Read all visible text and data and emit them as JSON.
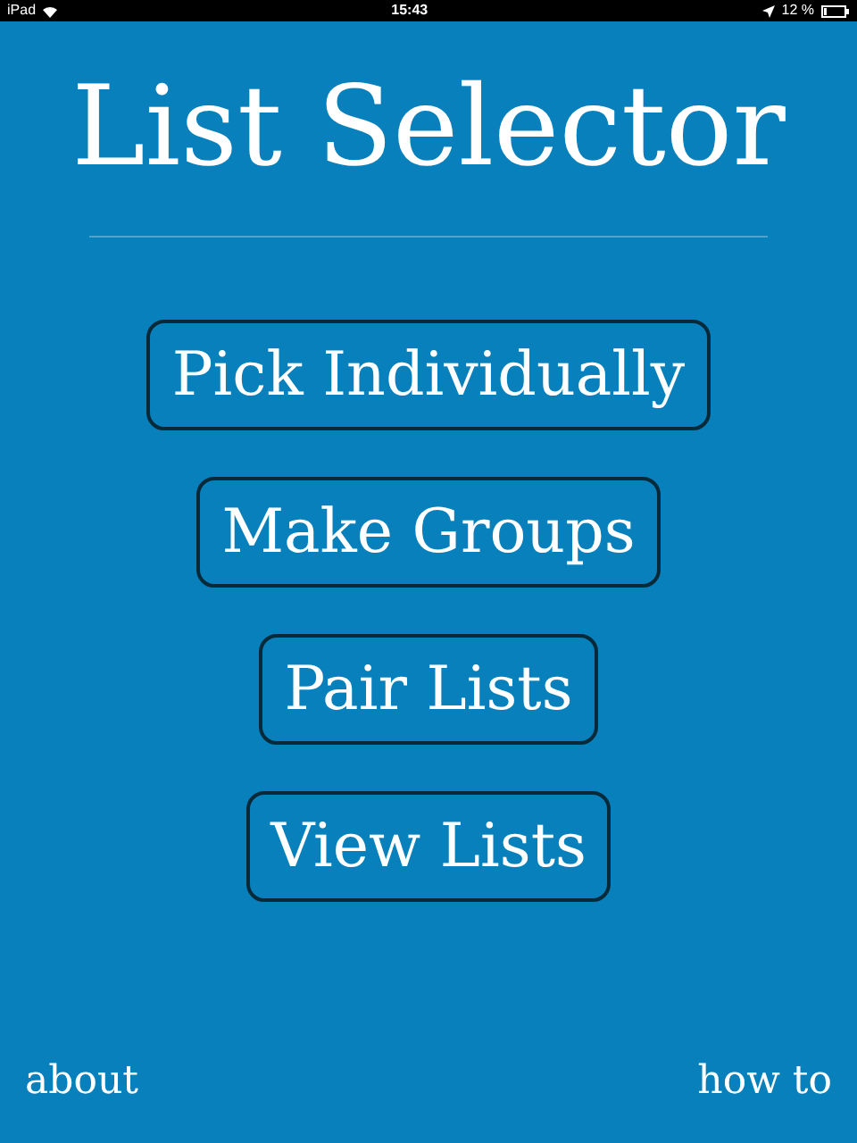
{
  "status_bar": {
    "device": "iPad",
    "time": "15:43",
    "battery": "12 %"
  },
  "title": "List Selector",
  "buttons": [
    "Pick Individually",
    "Make Groups",
    "Pair Lists",
    "View Lists"
  ],
  "footer": {
    "left": "about",
    "right": "how to"
  }
}
